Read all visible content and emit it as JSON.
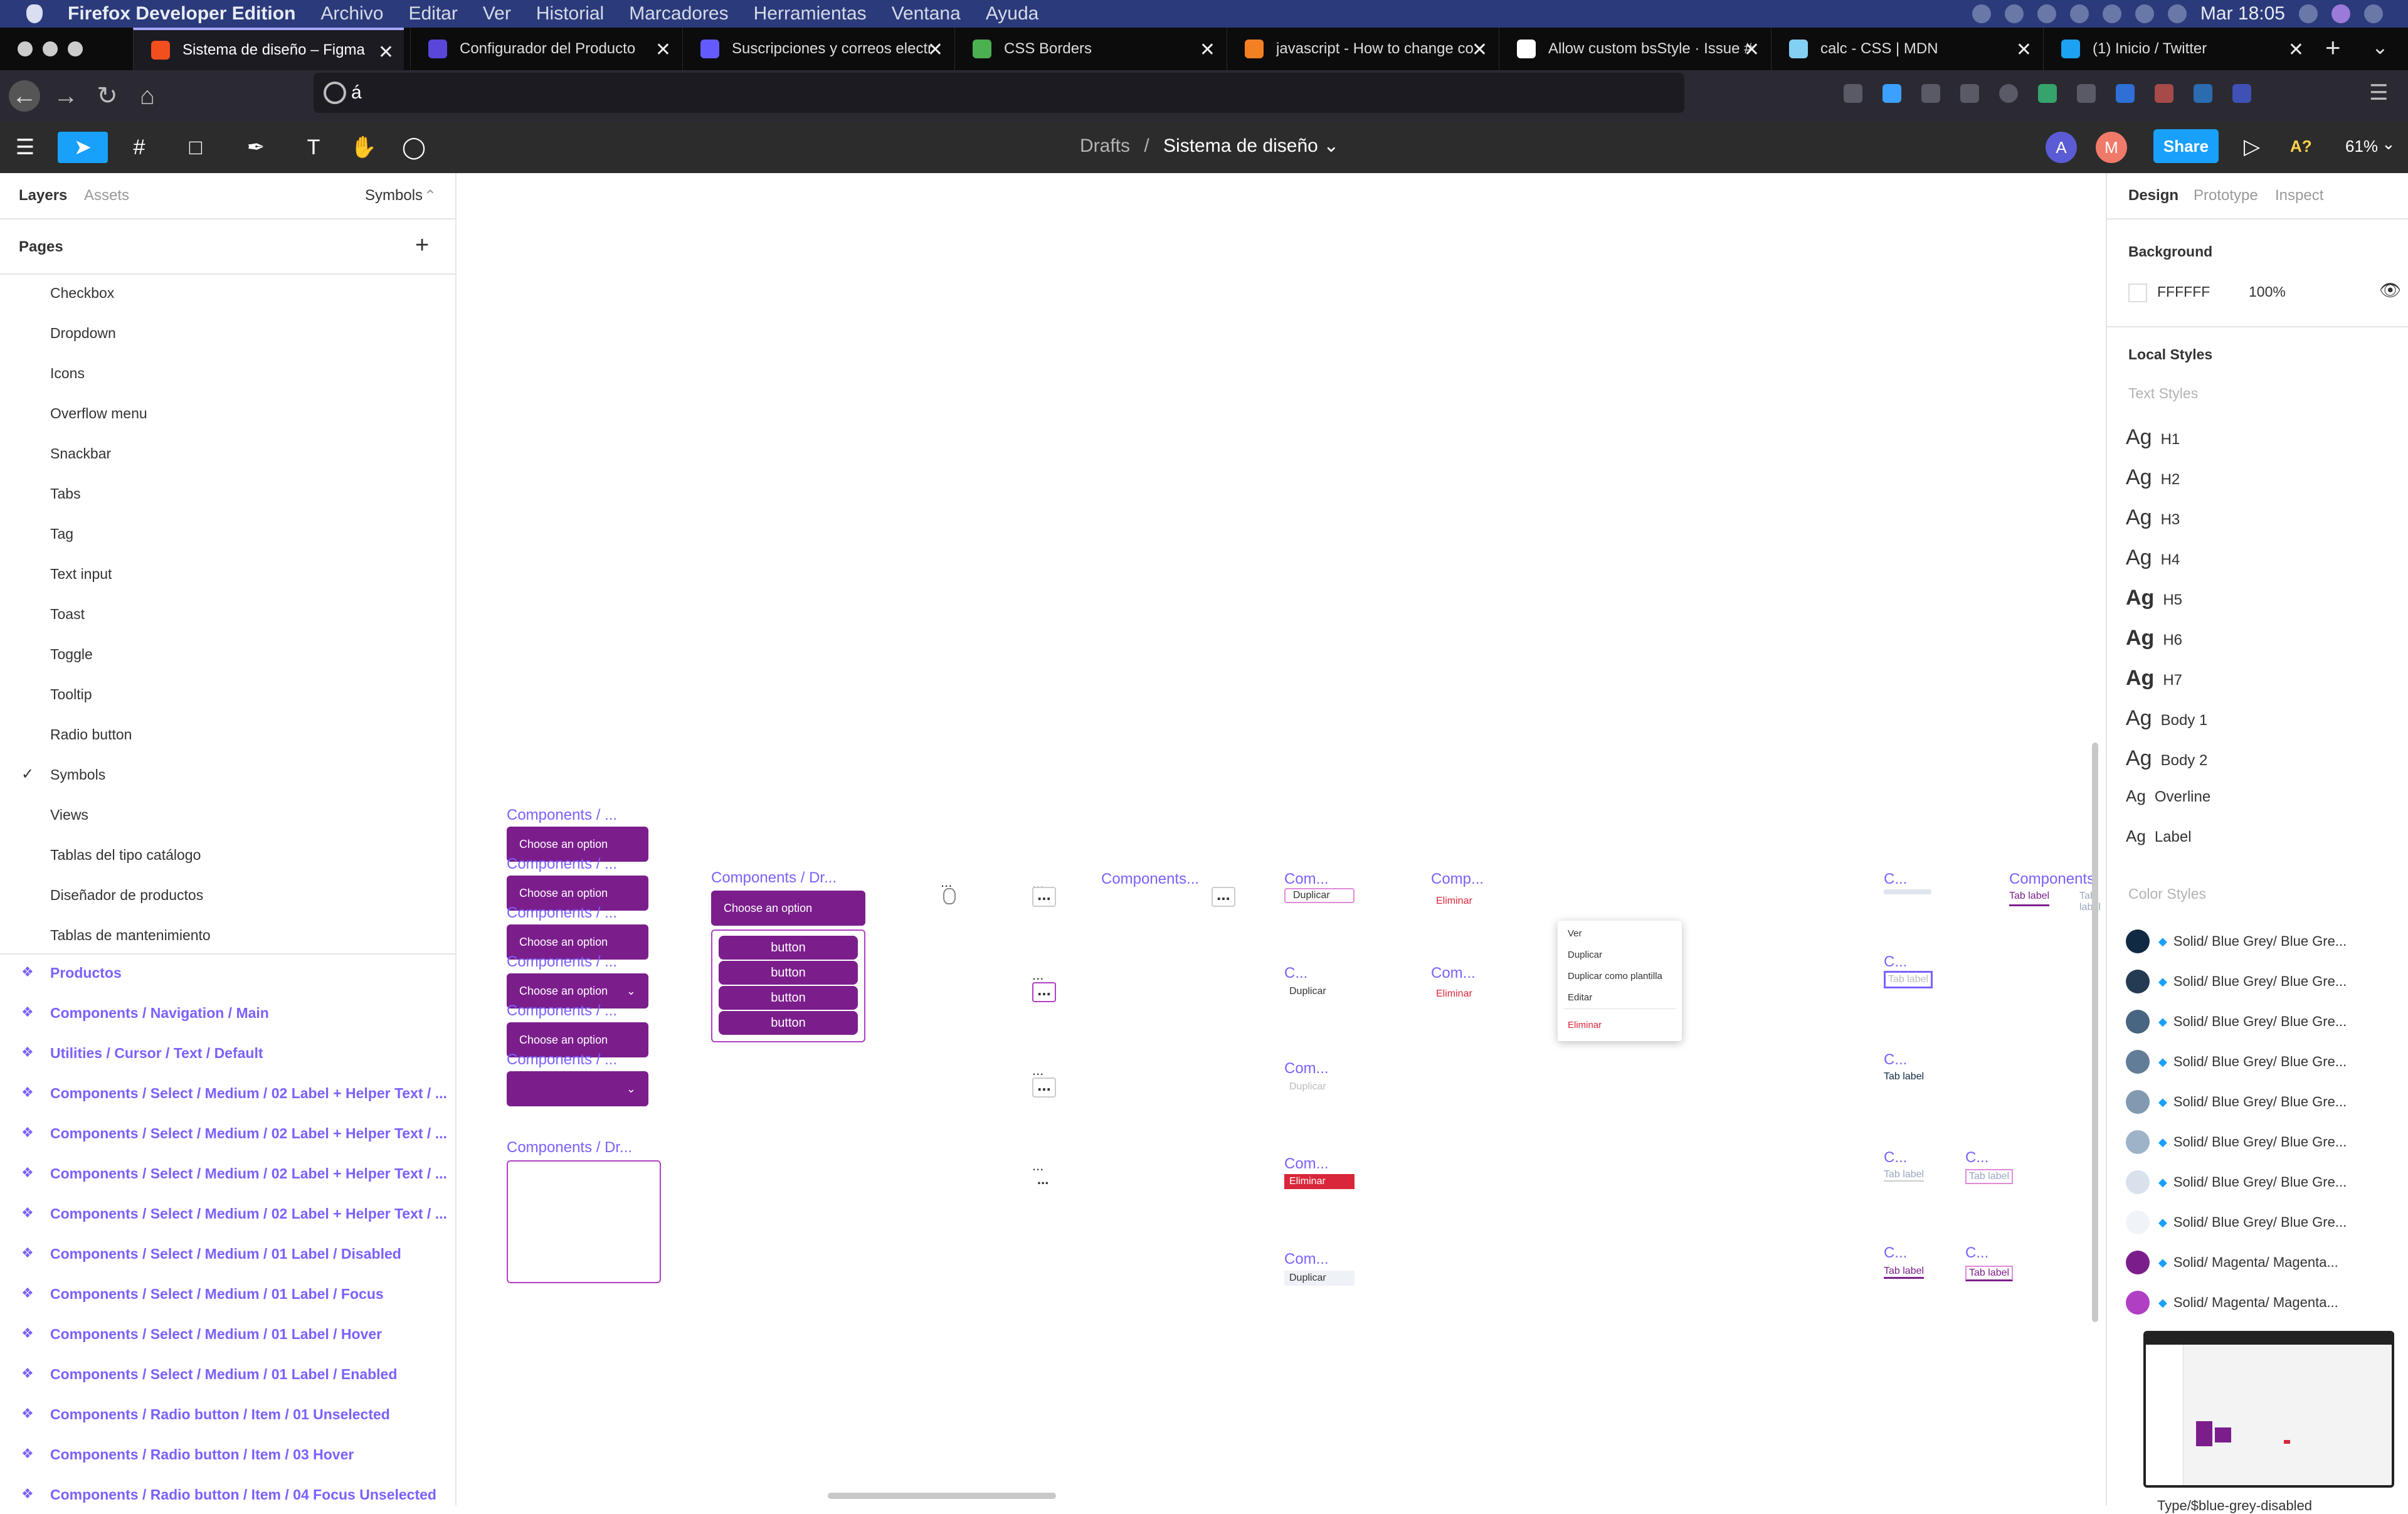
{
  "macos_menubar": {
    "app_name": "Firefox Developer Edition",
    "menus": [
      "Archivo",
      "Editar",
      "Ver",
      "Historial",
      "Marcadores",
      "Herramientas",
      "Ventana",
      "Ayuda"
    ],
    "clock": "Mar 18:05"
  },
  "browser": {
    "tabs": [
      {
        "title": "Sistema de diseño – Figma",
        "color": "#f24e1e"
      },
      {
        "title": "Configurador del Producto",
        "color": "#5a47d9"
      },
      {
        "title": "Suscripciones y correos electr",
        "color": "#635bff"
      },
      {
        "title": "CSS Borders",
        "color": "#4caf50"
      },
      {
        "title": "javascript - How to change co",
        "color": "#f48024"
      },
      {
        "title": "Allow custom bsStyle · Issue #",
        "color": "#ffffff"
      },
      {
        "title": "calc - CSS | MDN",
        "color": "#83d0f2"
      },
      {
        "title": "(1) Inicio / Twitter",
        "color": "#1da1f2"
      }
    ],
    "new_tab_label": "+",
    "url_value": "á"
  },
  "figma": {
    "breadcrumb_parent": "Drafts",
    "breadcrumb_sep": "/",
    "file_name": "Sistema de diseño",
    "avatar_a": "A",
    "avatar_m": "M",
    "share_label": "Share",
    "a11y_label": "A?",
    "zoom": "61%",
    "left_tabs": {
      "layers": "Layers",
      "assets": "Assets",
      "page_picker": "Symbols"
    },
    "pages_label": "Pages",
    "add_label": "+",
    "pages": [
      "Checkbox",
      "Dropdown",
      "Icons",
      "Overflow menu",
      "Snackbar",
      "Tabs",
      "Tag",
      "Text input",
      "Toast",
      "Toggle",
      "Tooltip",
      "Radio button",
      "Symbols",
      "Views",
      "Tablas del tipo catálogo",
      "Diseñador de productos",
      "Tablas de mantenimiento"
    ],
    "current_page_check": "✓",
    "layers": [
      "Productos",
      "Components / Navigation / Main",
      "Utilities / Cursor / Text / Default",
      "Components / Select / Medium / 02 Label + Helper Text / ...",
      "Components / Select / Medium / 02 Label + Helper Text / ...",
      "Components / Select / Medium / 02 Label + Helper Text / ...",
      "Components / Select / Medium / 02 Label + Helper Text / ...",
      "Components / Select / Medium / 01 Label / Disabled",
      "Components / Select / Medium / 01 Label / Focus",
      "Components / Select / Medium / 01 Label / Hover",
      "Components / Select / Medium / 01 Label / Enabled",
      "Components / Radio button / Item / 01 Unselected",
      "Components / Radio button / Item / 03 Hover",
      "Components / Radio button / Item / 04 Focus Unselected"
    ],
    "right_tabs": {
      "design": "Design",
      "prototype": "Prototype",
      "inspect": "Inspect"
    },
    "background_label": "Background",
    "background_hex": "FFFFFF",
    "background_opacity": "100%",
    "local_styles_label": "Local Styles",
    "text_styles_label": "Text Styles",
    "ag": "Ag",
    "text_styles": [
      "H1",
      "H2",
      "H3",
      "H4",
      "H5",
      "H6",
      "H7",
      "Body 1",
      "Body 2",
      "Overline",
      "Label"
    ],
    "color_styles_label": "Color Styles",
    "color_styles": [
      {
        "name": "Solid/ Blue Grey/ Blue Gre...",
        "color": "#102a43"
      },
      {
        "name": "Solid/ Blue Grey/ Blue Gre...",
        "color": "#243b53"
      },
      {
        "name": "Solid/ Blue Grey/ Blue Gre...",
        "color": "#486581"
      },
      {
        "name": "Solid/ Blue Grey/ Blue Gre...",
        "color": "#627d98"
      },
      {
        "name": "Solid/ Blue Grey/ Blue Gre...",
        "color": "#829ab1"
      },
      {
        "name": "Solid/ Blue Grey/ Blue Gre...",
        "color": "#9fb3c8"
      },
      {
        "name": "Solid/ Blue Grey/ Blue Gre...",
        "color": "#d9e2ec"
      },
      {
        "name": "Solid/ Blue Grey/ Blue Gre...",
        "color": "#f0f4f8"
      },
      {
        "name": "Solid/ Magenta/ Magenta...",
        "color": "#7b1e8c"
      },
      {
        "name": "Solid/ Magenta/ Magenta...",
        "color": "#b03fc4"
      }
    ],
    "last_style_partial": "Type/$blue-grey-disabled",
    "canvas": {
      "comp_full": "Components / ...",
      "comp_dr": "Components / Dr...",
      "comp_components": "Components...",
      "comp_com": "Com...",
      "comp_comp": "Comp...",
      "comp_c": "C...",
      "comp_components_right": "Components",
      "choose_option": "Choose an option",
      "button_label": "button",
      "dots_label": "...",
      "duplicar": "Duplicar",
      "eliminar": "Eliminar",
      "tab_label": "Tab label",
      "context_menu": [
        "Ver",
        "Duplicar",
        "Duplicar como plantilla",
        "Editar",
        "Eliminar"
      ]
    }
  }
}
